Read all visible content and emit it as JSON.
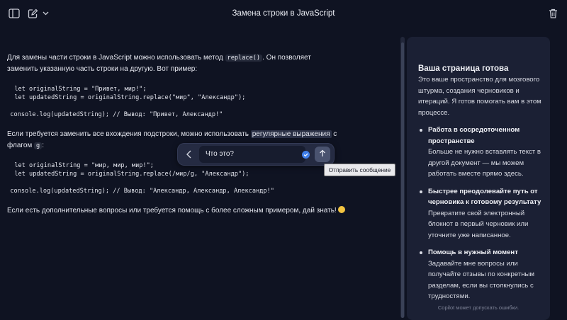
{
  "header": {
    "title": "Замена строки в JavaScript",
    "icons": {
      "sidebar": "sidebar-toggle-icon",
      "new": "compose-icon",
      "dropdown": "chevron-down-icon",
      "delete": "trash-icon"
    }
  },
  "doc": {
    "p1_a": "Для замены части строки в JavaScript можно использовать метод ",
    "p1_code": "replace()",
    "p1_b": ". Он позволяет заменить указанную часть строки на другую. Вот пример:",
    "code1": [
      "  let originalString = \"Привет, мир!\";",
      "  let updatedString = originalString.replace(\"мир\", \"Александр\");",
      "",
      "  console.log(updatedString); // Вывод: \"Привет, Александр!\""
    ],
    "p2_a": "Если требуется заменить все вхождения подстроки, можно использовать ",
    "p2_hl": "регулярные выражения",
    "p2_b": " с флагом ",
    "p2_code": "g",
    "p2_c": ":",
    "code2": [
      "  let originalString = \"мир, мир, мир!\";",
      "  let updatedString = originalString.replace(/мир/g, \"Александр\");",
      "",
      "  console.log(updatedString); // Вывод: \"Александр, Александр, Александр!\""
    ],
    "p3": "Если есть дополнительные вопросы или требуется помощь с более сложным примером, дай знать!"
  },
  "ask": {
    "question": "Что это?",
    "tooltip": "Отправить сообщение",
    "icons": {
      "back": "chevron-left-icon",
      "badge": "check-badge-icon",
      "send": "arrow-up-icon"
    }
  },
  "panel": {
    "title": "Ваша страница готова",
    "intro": "Это ваше пространство для мозгового штурма, создания черновиков и итераций. Я готов помогать вам в этом процессе.",
    "features": [
      {
        "title": "Работа в сосредоточенном пространстве",
        "text": "Больше не нужно вставлять текст в другой документ — мы можем работать вместе прямо здесь."
      },
      {
        "title": "Быстрее преодолевайте путь от черновика к готовому результату",
        "text": "Превратите свой электронный блокнот в первый черновик или уточните уже написанное."
      },
      {
        "title": "Помощь в нужный момент",
        "text": "Задавайте мне вопросы или получайте отзывы по конкретным разделам, если вы столкнулись с трудностями."
      }
    ],
    "disclaimer": "Copilot может допускать ошибки."
  },
  "colors": {
    "background": "#0f1322",
    "panel": "#1b2034",
    "accent": "#3f7ee8"
  }
}
